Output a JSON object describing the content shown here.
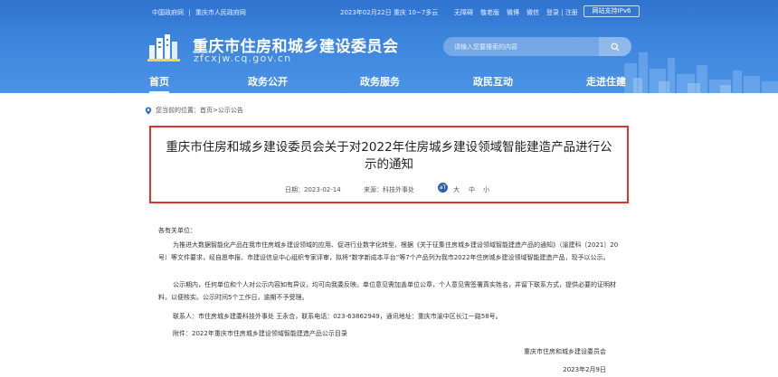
{
  "topbar": {
    "left_links": [
      "中国政府网",
      "|",
      "重庆市人民政府网"
    ],
    "weather": "2023年02月22日 重庆 10~7多云",
    "right_links": [
      "无障碍",
      "敬老版",
      "微博",
      "微信",
      "登录 | 注册"
    ],
    "ipv6": "网站支持IPv6"
  },
  "site": {
    "title": "重庆市住房和城乡建设委员会",
    "domain": "zfcxjw.cq.gov.cn"
  },
  "search": {
    "placeholder": "请输入您要搜索的内容"
  },
  "nav": [
    {
      "label": "首页"
    },
    {
      "label": "政务公开"
    },
    {
      "label": "政务服务"
    },
    {
      "label": "政民互动"
    },
    {
      "label": "走进住建"
    }
  ],
  "breadcrumb": {
    "prefix": "您当前的位置：",
    "home": "首页",
    "sep": ">",
    "current": "公示公告"
  },
  "article": {
    "title": "重庆市住房和城乡建设委员会关于对2022年住房城乡建设领域智能建造产品进行公示的通知",
    "date": "日期：2023-02-14",
    "source": "来源：科技外事处",
    "font_icon": "aT",
    "font_big": "大",
    "font_mid": "中",
    "font_small": "小",
    "salutation": "各有关单位：",
    "p1": "为推进大数据智能化产品在我市住房城乡建设领域的应用、促进行业数字化转型，根据《关于征集住房城乡建设领域智能建造产品的通知》（渝建科〔2021〕20号）等文件要求，经自愿申报、市建设信息中心组织专家评审，拟将“数字新成本平台”等7个产品列为我市2022年住房城乡建设领域智能建造产品，现予以公示。",
    "p2": "公示期内，任何单位和个人对公示内容如有异议，均可向我委反映。单位意见需加盖单位公章，个人意见需签署真实姓名，并留下联系方式，提供必要的证明材料，以便核实。公示时间5个工作日，逾期不予受理。",
    "p3": "联系人：市住房城乡建委科技外事处 王永合，联系电话：023-63862949，通讯地址：重庆市渝中区长江一路58号。",
    "p4": "附件：2022年重庆市住房城乡建设领域智能建造产品公示目录",
    "sign_org": "重庆市住房和城乡建设委员会",
    "sign_date": "2023年2月9日"
  },
  "colors": {
    "header_blue": "#3d86dd",
    "title_border": "#e0322e",
    "font_icon_bg": "#2f5fa8"
  }
}
